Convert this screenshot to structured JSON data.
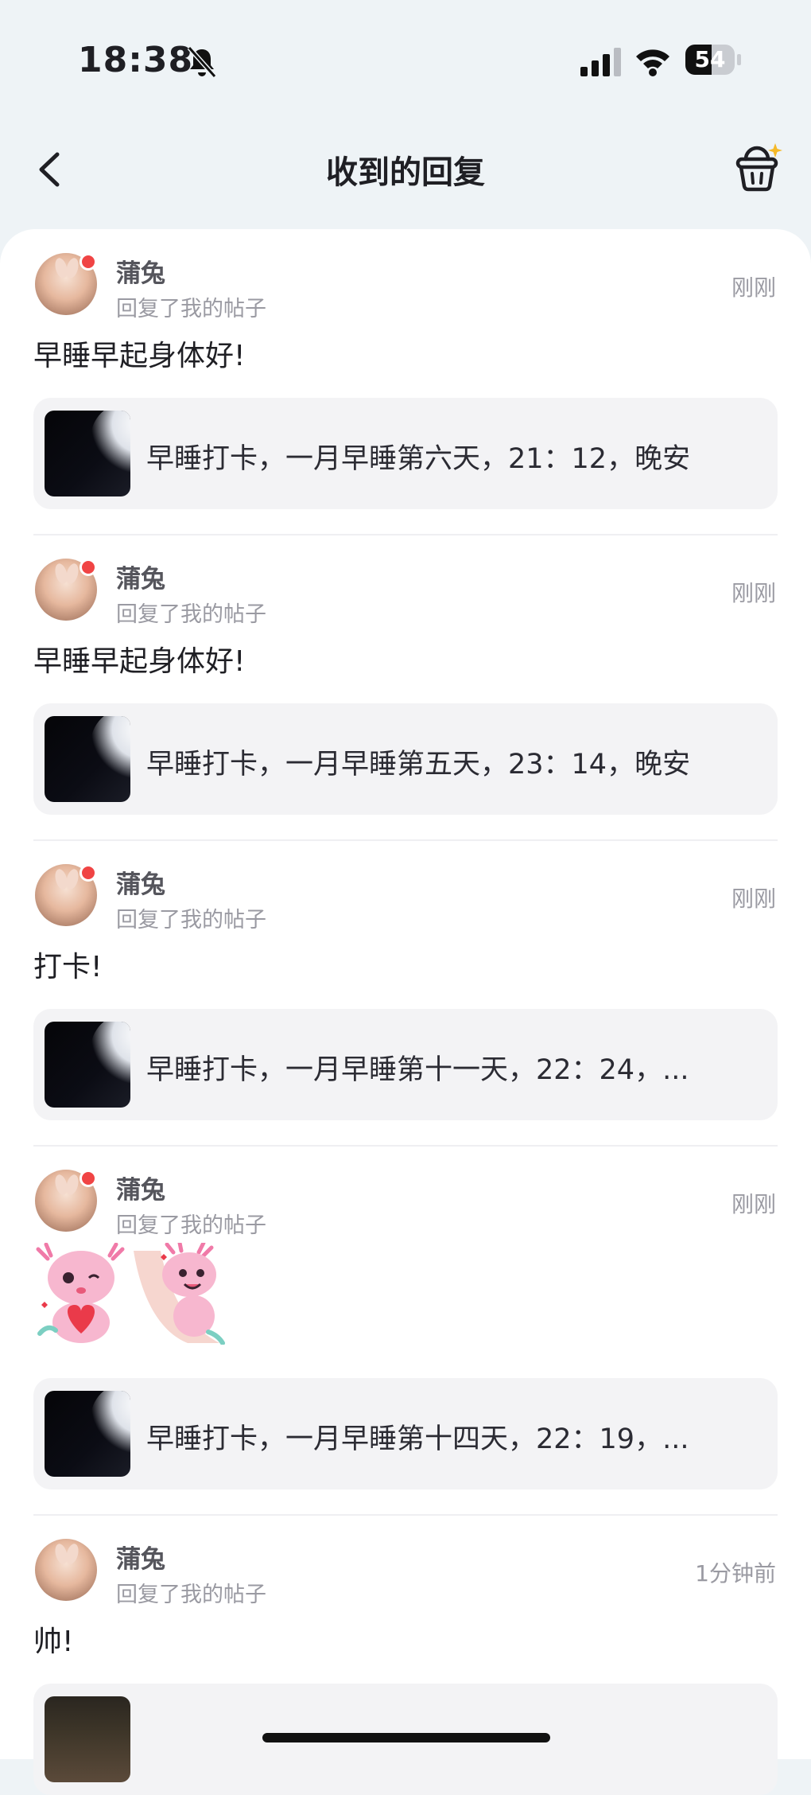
{
  "status": {
    "time": "18:38",
    "battery": "54",
    "battery_level": 0.54
  },
  "nav": {
    "title": "收到的回复"
  },
  "replies": [
    {
      "user": "蒲兔",
      "action": "回复了我的帖子",
      "time": "刚刚",
      "content": "早睡早起身体好!",
      "post": "早睡打卡，一月早睡第六天，21：12，晚安",
      "unread": true
    },
    {
      "user": "蒲兔",
      "action": "回复了我的帖子",
      "time": "刚刚",
      "content": "早睡早起身体好!",
      "post": "早睡打卡，一月早睡第五天，23：14，晚安",
      "unread": true
    },
    {
      "user": "蒲兔",
      "action": "回复了我的帖子",
      "time": "刚刚",
      "content": "打卡!",
      "post": "早睡打卡，一月早睡第十一天，22：24，...",
      "unread": true
    },
    {
      "user": "蒲兔",
      "action": "回复了我的帖子",
      "time": "刚刚",
      "content": "",
      "post": "早睡打卡，一月早睡第十四天，22：19，...",
      "unread": true
    },
    {
      "user": "蒲兔",
      "action": "回复了我的帖子",
      "time": "1分钟前",
      "content": "帅!",
      "post": "",
      "unread": false
    }
  ]
}
